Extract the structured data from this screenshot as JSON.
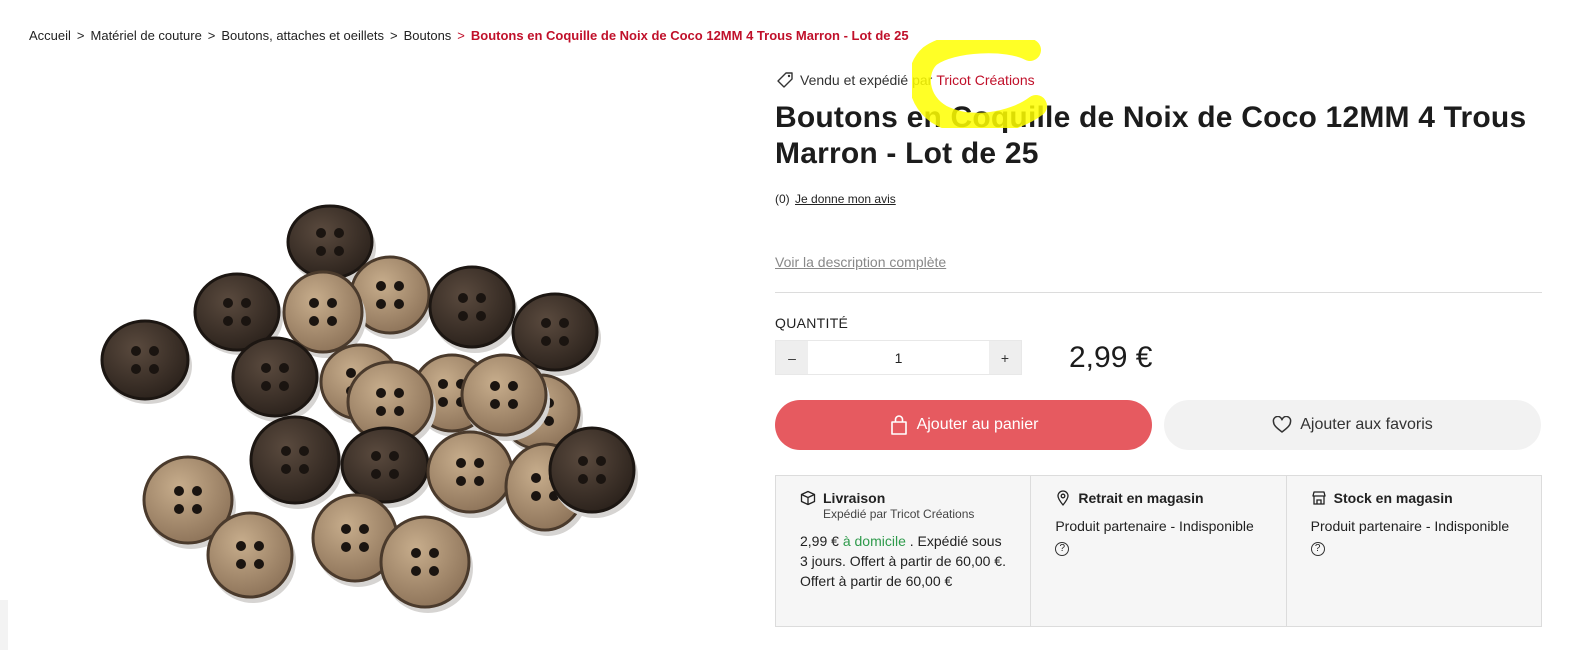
{
  "breadcrumb": {
    "items": [
      "Accueil",
      "Matériel de couture",
      "Boutons, attaches et oeillets",
      "Boutons"
    ],
    "separator": ">",
    "current": "Boutons en Coquille de Noix de Coco 12MM 4 Trous Marron - Lot de 25"
  },
  "seller": {
    "prefix": "Vendu et expédié par",
    "name": "Tricot Créations",
    "icon": "tag-icon"
  },
  "product": {
    "title": "Boutons en Coquille de Noix de Coco 12MM 4 Trous Marron - Lot de 25",
    "reviews_count": "(0)",
    "review_link": "Je donne mon avis",
    "description_link": "Voir la description complète",
    "image_alt": "coconut-shell-buttons-photo"
  },
  "quantity": {
    "label": "QUANTITÉ",
    "minus": "–",
    "plus": "+",
    "value": "1"
  },
  "price": "2,99 €",
  "actions": {
    "cart_label": "Ajouter au panier",
    "fav_label": "Ajouter aux favoris"
  },
  "delivery": {
    "livraison": {
      "title": "Livraison",
      "subtitle": "Expédié par Tricot Créations",
      "price": "2,99 €",
      "mode": "à domicile",
      "details": ". Expédié sous 3 jours. Offert à partir de 60,00 €. Offert à partir de 60,00 €"
    },
    "retrait": {
      "title": "Retrait en magasin",
      "body": "Produit partenaire - Indisponible",
      "help": "?"
    },
    "stock": {
      "title": "Stock en magasin",
      "body": "Produit partenaire - Indisponible",
      "help": "?"
    }
  },
  "colors": {
    "accent_red": "#c0102a",
    "cart_button": "#e65a60",
    "green": "#2e9a4b",
    "highlight": "#ffff00"
  }
}
